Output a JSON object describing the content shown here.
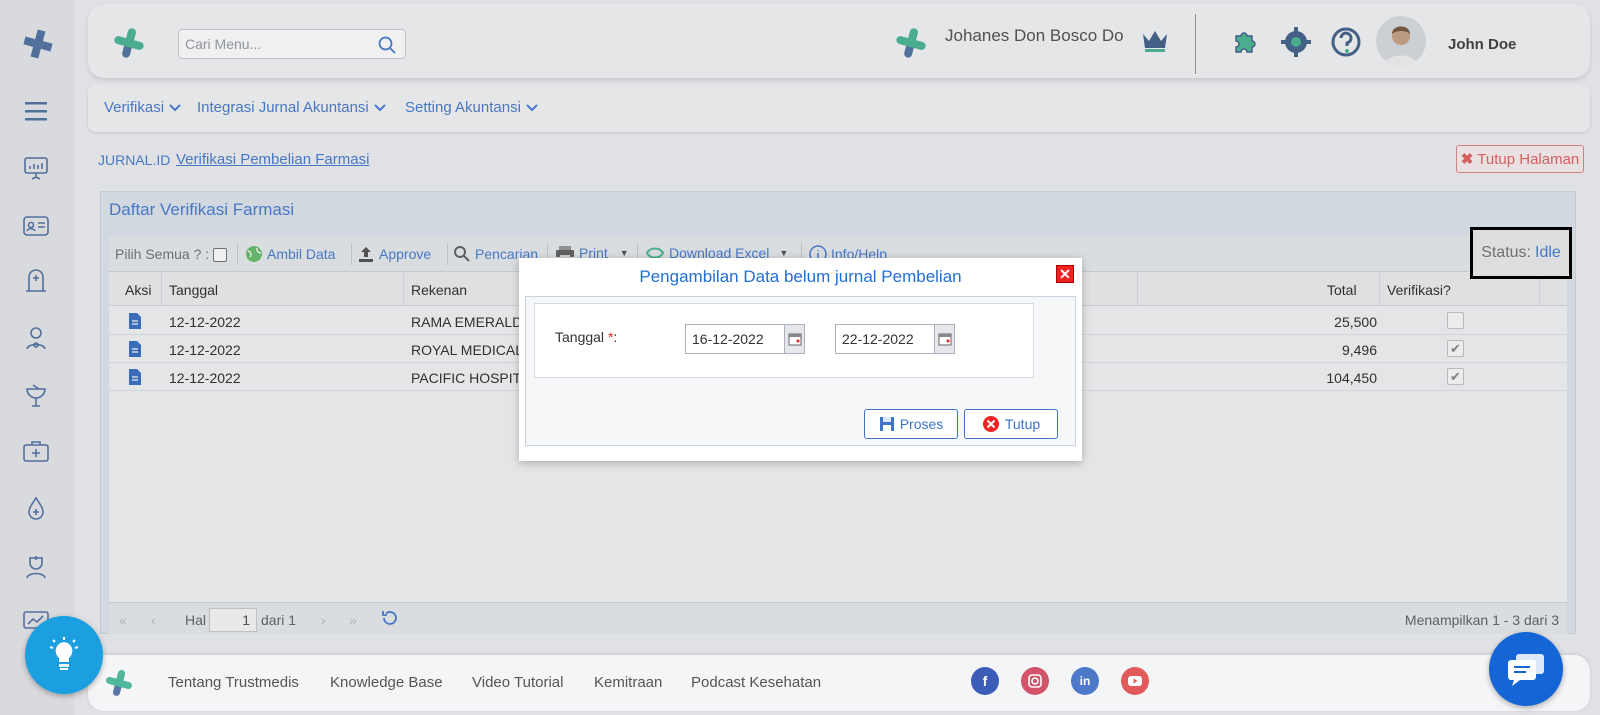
{
  "header": {
    "search_placeholder": "Cari Menu...",
    "clinic_name": "Johanes Don Bosco Do",
    "user_name": "John Doe"
  },
  "nav": {
    "items": [
      {
        "label": "Verifikasi"
      },
      {
        "label": "Integrasi Jurnal Akuntansi"
      },
      {
        "label": "Setting Akuntansi"
      }
    ]
  },
  "breadcrumb": {
    "root": "JURNAL.ID",
    "current": "Verifikasi Pembelian Farmasi"
  },
  "close_page_label": "Tutup Halaman",
  "panel": {
    "title": "Daftar Verifikasi Farmasi",
    "toolbar": {
      "select_all_label": "Pilih Semua ? :",
      "fetch_label": "Ambil Data",
      "approve_label": "Approve",
      "search_label": "Pencarian",
      "print_label": "Print",
      "excel_label": "Download Excel",
      "help_label": "Info/Help"
    },
    "status": {
      "label": "Status:",
      "value": "Idle"
    },
    "columns": [
      "Aksi",
      "Tanggal",
      "Rekenan",
      "Total",
      "Verifikasi?"
    ],
    "rows": [
      {
        "tanggal": "12-12-2022",
        "rekenan": "RAMA EMERALD",
        "total": "25,500",
        "verified": false
      },
      {
        "tanggal": "12-12-2022",
        "rekenan": "ROYAL MEDICAL",
        "total": "9,496",
        "verified": true
      },
      {
        "tanggal": "12-12-2022",
        "rekenan": "PACIFIC HOSPITA",
        "total": "104,450",
        "verified": true
      }
    ],
    "pager": {
      "page_label": "Hal",
      "page_value": "1",
      "of_label": "dari 1",
      "summary": "Menampilkan 1 - 3 dari 3"
    }
  },
  "modal": {
    "title": "Pengambilan Data belum jurnal Pembelian",
    "field_label": "Tanggal",
    "required_mark": "*",
    "colon": ":",
    "date_from": "16-12-2022",
    "date_to": "22-12-2022",
    "process_label": "Proses",
    "close_label": "Tutup"
  },
  "footer": {
    "links": [
      "Tentang Trustmedis",
      "Knowledge Base",
      "Video Tutorial",
      "Kemitraan",
      "Podcast Kesehatan"
    ]
  },
  "colors": {
    "accent": "#4d7fd1",
    "brand_blue": "#5877a6",
    "brand_green": "#4fb89a",
    "danger": "#e22222"
  }
}
